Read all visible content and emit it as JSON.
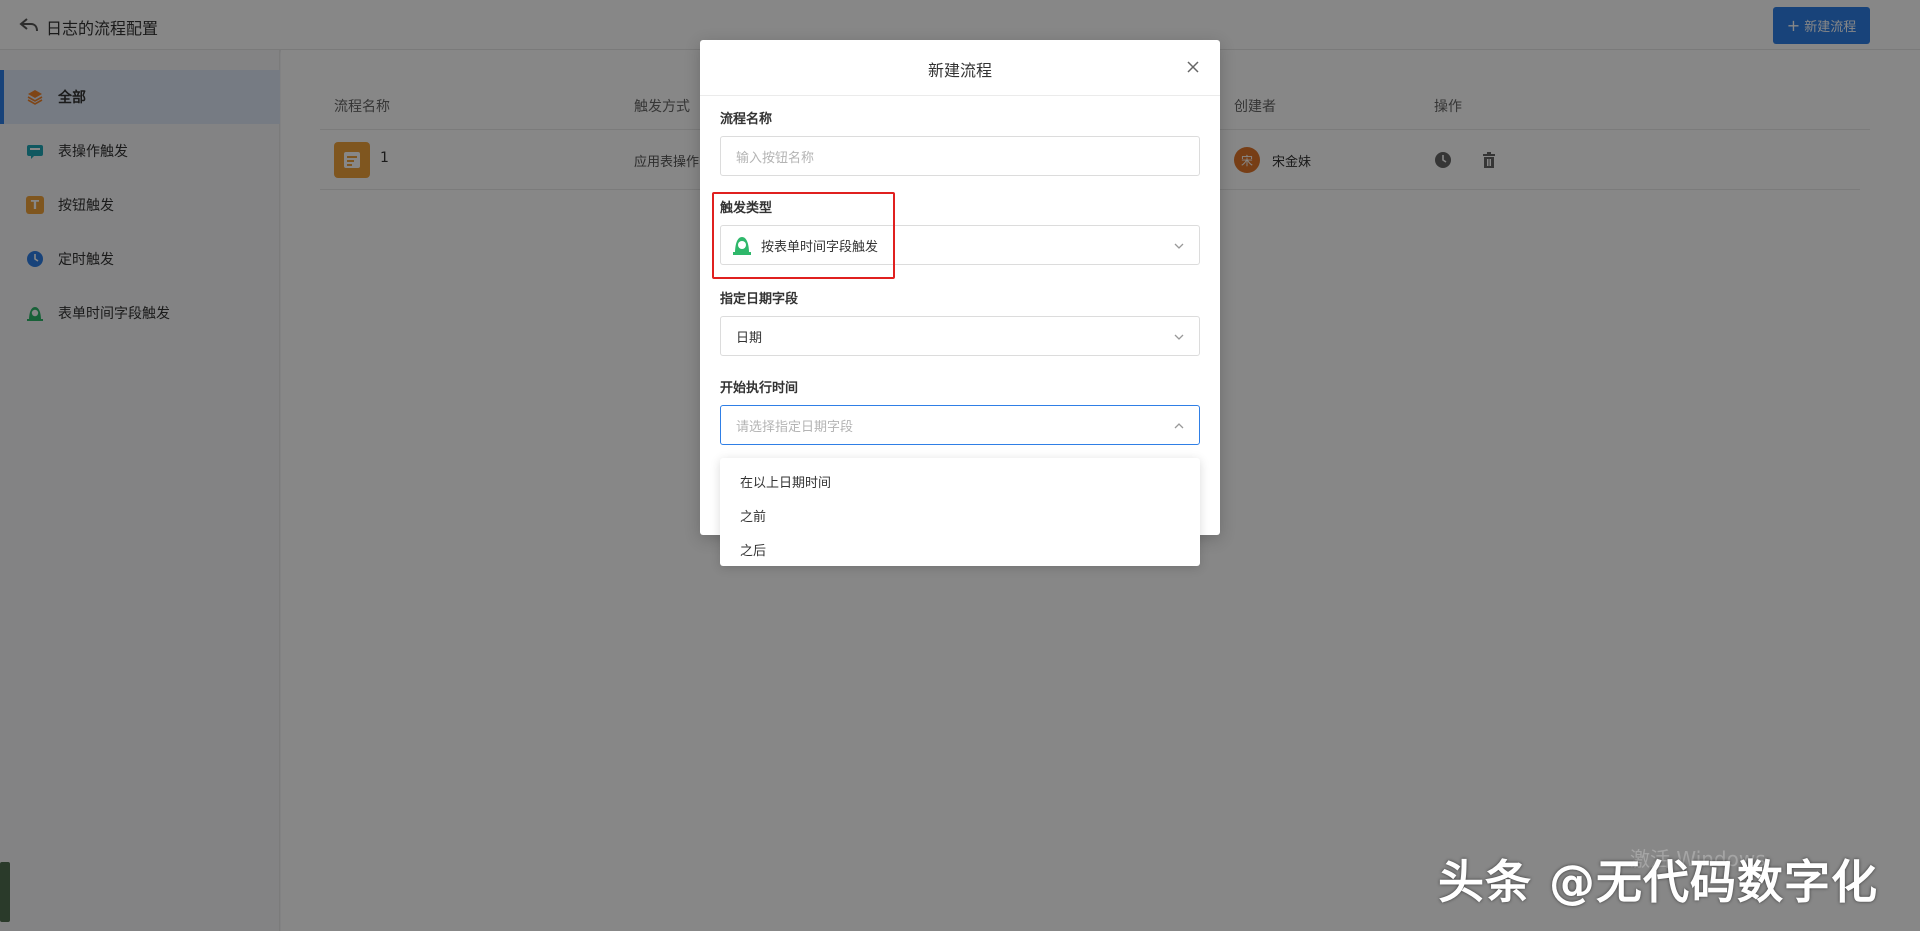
{
  "header": {
    "title": "日志的流程配置",
    "new_button": "新建流程"
  },
  "sidebar": {
    "items": [
      {
        "label": "全部",
        "icon": "layers-icon",
        "color": "#f0822a"
      },
      {
        "label": "表操作触发",
        "icon": "table-action-icon",
        "color": "#1fa6b5"
      },
      {
        "label": "按钮触发",
        "icon": "button-t-icon",
        "color": "#f0a23c"
      },
      {
        "label": "定时触发",
        "icon": "clock-icon",
        "color": "#2f7fe6"
      },
      {
        "label": "表单时间字段触发",
        "icon": "alarm-icon",
        "color": "#2fb86b"
      }
    ]
  },
  "table": {
    "columns": [
      "流程名称",
      "触发方式",
      "创建者",
      "操作"
    ],
    "rows": [
      {
        "name": "1",
        "trigger": "应用表操作",
        "creator_avatar": "宋",
        "creator": "宋金妹"
      }
    ]
  },
  "modal": {
    "title": "新建流程",
    "fields": {
      "name_label": "流程名称",
      "name_placeholder": "输入按钮名称",
      "trigger_label": "触发类型",
      "trigger_value": "按表单时间字段触发",
      "date_field_label": "指定日期字段",
      "date_field_value": "日期",
      "start_time_label": "开始执行时间",
      "start_time_placeholder": "请选择指定日期字段"
    },
    "dropdown_options": [
      "在以上日期时间",
      "之前",
      "之后"
    ]
  },
  "watermark": {
    "activation": "激活 Windows",
    "brand": "头条 @无代码数字化"
  }
}
